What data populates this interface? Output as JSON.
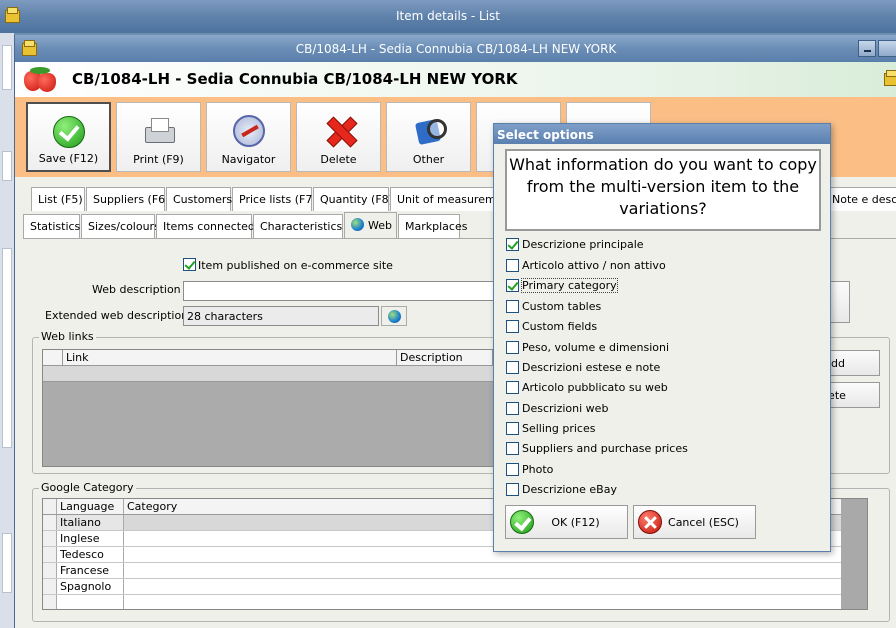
{
  "outer_window": {
    "title": "Item details  -  List"
  },
  "inner_window": {
    "title": "CB/1084-LH - Sedia Connubia CB/1084-LH NEW YORK"
  },
  "header": {
    "title": "CB/1084-LH - Sedia Connubia CB/1084-LH NEW YORK"
  },
  "toolbar": {
    "buttons": [
      {
        "label": "Save (F12)",
        "icon": "check-icon"
      },
      {
        "label": "Print (F9)",
        "icon": "printer-icon"
      },
      {
        "label": "Navigator",
        "icon": "compass-icon"
      },
      {
        "label": "Delete",
        "icon": "delete-icon"
      },
      {
        "label": "Other",
        "icon": "search-icon"
      }
    ]
  },
  "tabs_row1": [
    "List (F5)",
    "Suppliers (F6)",
    "Customers",
    "Price lists (F7)",
    "Quantity (F8)",
    "Unit of measurement",
    "Note e descriz"
  ],
  "tabs_row2": [
    "Statistics",
    "Sizes/colours",
    "Items connected",
    "Characteristics",
    "Web",
    "Markplaces"
  ],
  "web": {
    "published_label": "Item published on e-commerce site",
    "published_checked": true,
    "web_description_label": "Web description :",
    "web_description_value": "",
    "extended_label": "Extended web description :",
    "extended_value": "28 characters"
  },
  "web_links": {
    "group_label": "Web links",
    "columns": [
      "Link",
      "Description"
    ],
    "add_label": "dd",
    "delete_label": "lete"
  },
  "google_category": {
    "group_label": "Google Category",
    "columns": [
      "Language",
      "Category"
    ],
    "rows": [
      "Italiano",
      "Inglese",
      "Tedesco",
      "Francese",
      "Spagnolo"
    ]
  },
  "modal": {
    "title": "Select options",
    "question": "What information do you want to copy from the multi-version item to the variations?",
    "options": [
      {
        "label": "Descrizione principale",
        "checked": true
      },
      {
        "label": "Articolo attivo / non attivo",
        "checked": false
      },
      {
        "label": "Primary category",
        "checked": true
      },
      {
        "label": "Custom tables",
        "checked": false
      },
      {
        "label": "Custom fields",
        "checked": false
      },
      {
        "label": "Peso, volume e dimensioni",
        "checked": false
      },
      {
        "label": "Descrizioni estese e note",
        "checked": false
      },
      {
        "label": "Articolo pubblicato su web",
        "checked": false
      },
      {
        "label": "Descrizioni web",
        "checked": false
      },
      {
        "label": "Selling prices",
        "checked": false
      },
      {
        "label": "Suppliers and purchase prices",
        "checked": false
      },
      {
        "label": "Photo",
        "checked": false
      },
      {
        "label": "Descrizione eBay",
        "checked": false
      }
    ],
    "ok_label": "OK (F12)",
    "cancel_label": "Cancel (ESC)"
  },
  "colors": {
    "toolbar_bg": "#fbbf86",
    "title_bar": "#5f82ab",
    "accent_green": "#1d9a17",
    "accent_red": "#e5281b"
  }
}
